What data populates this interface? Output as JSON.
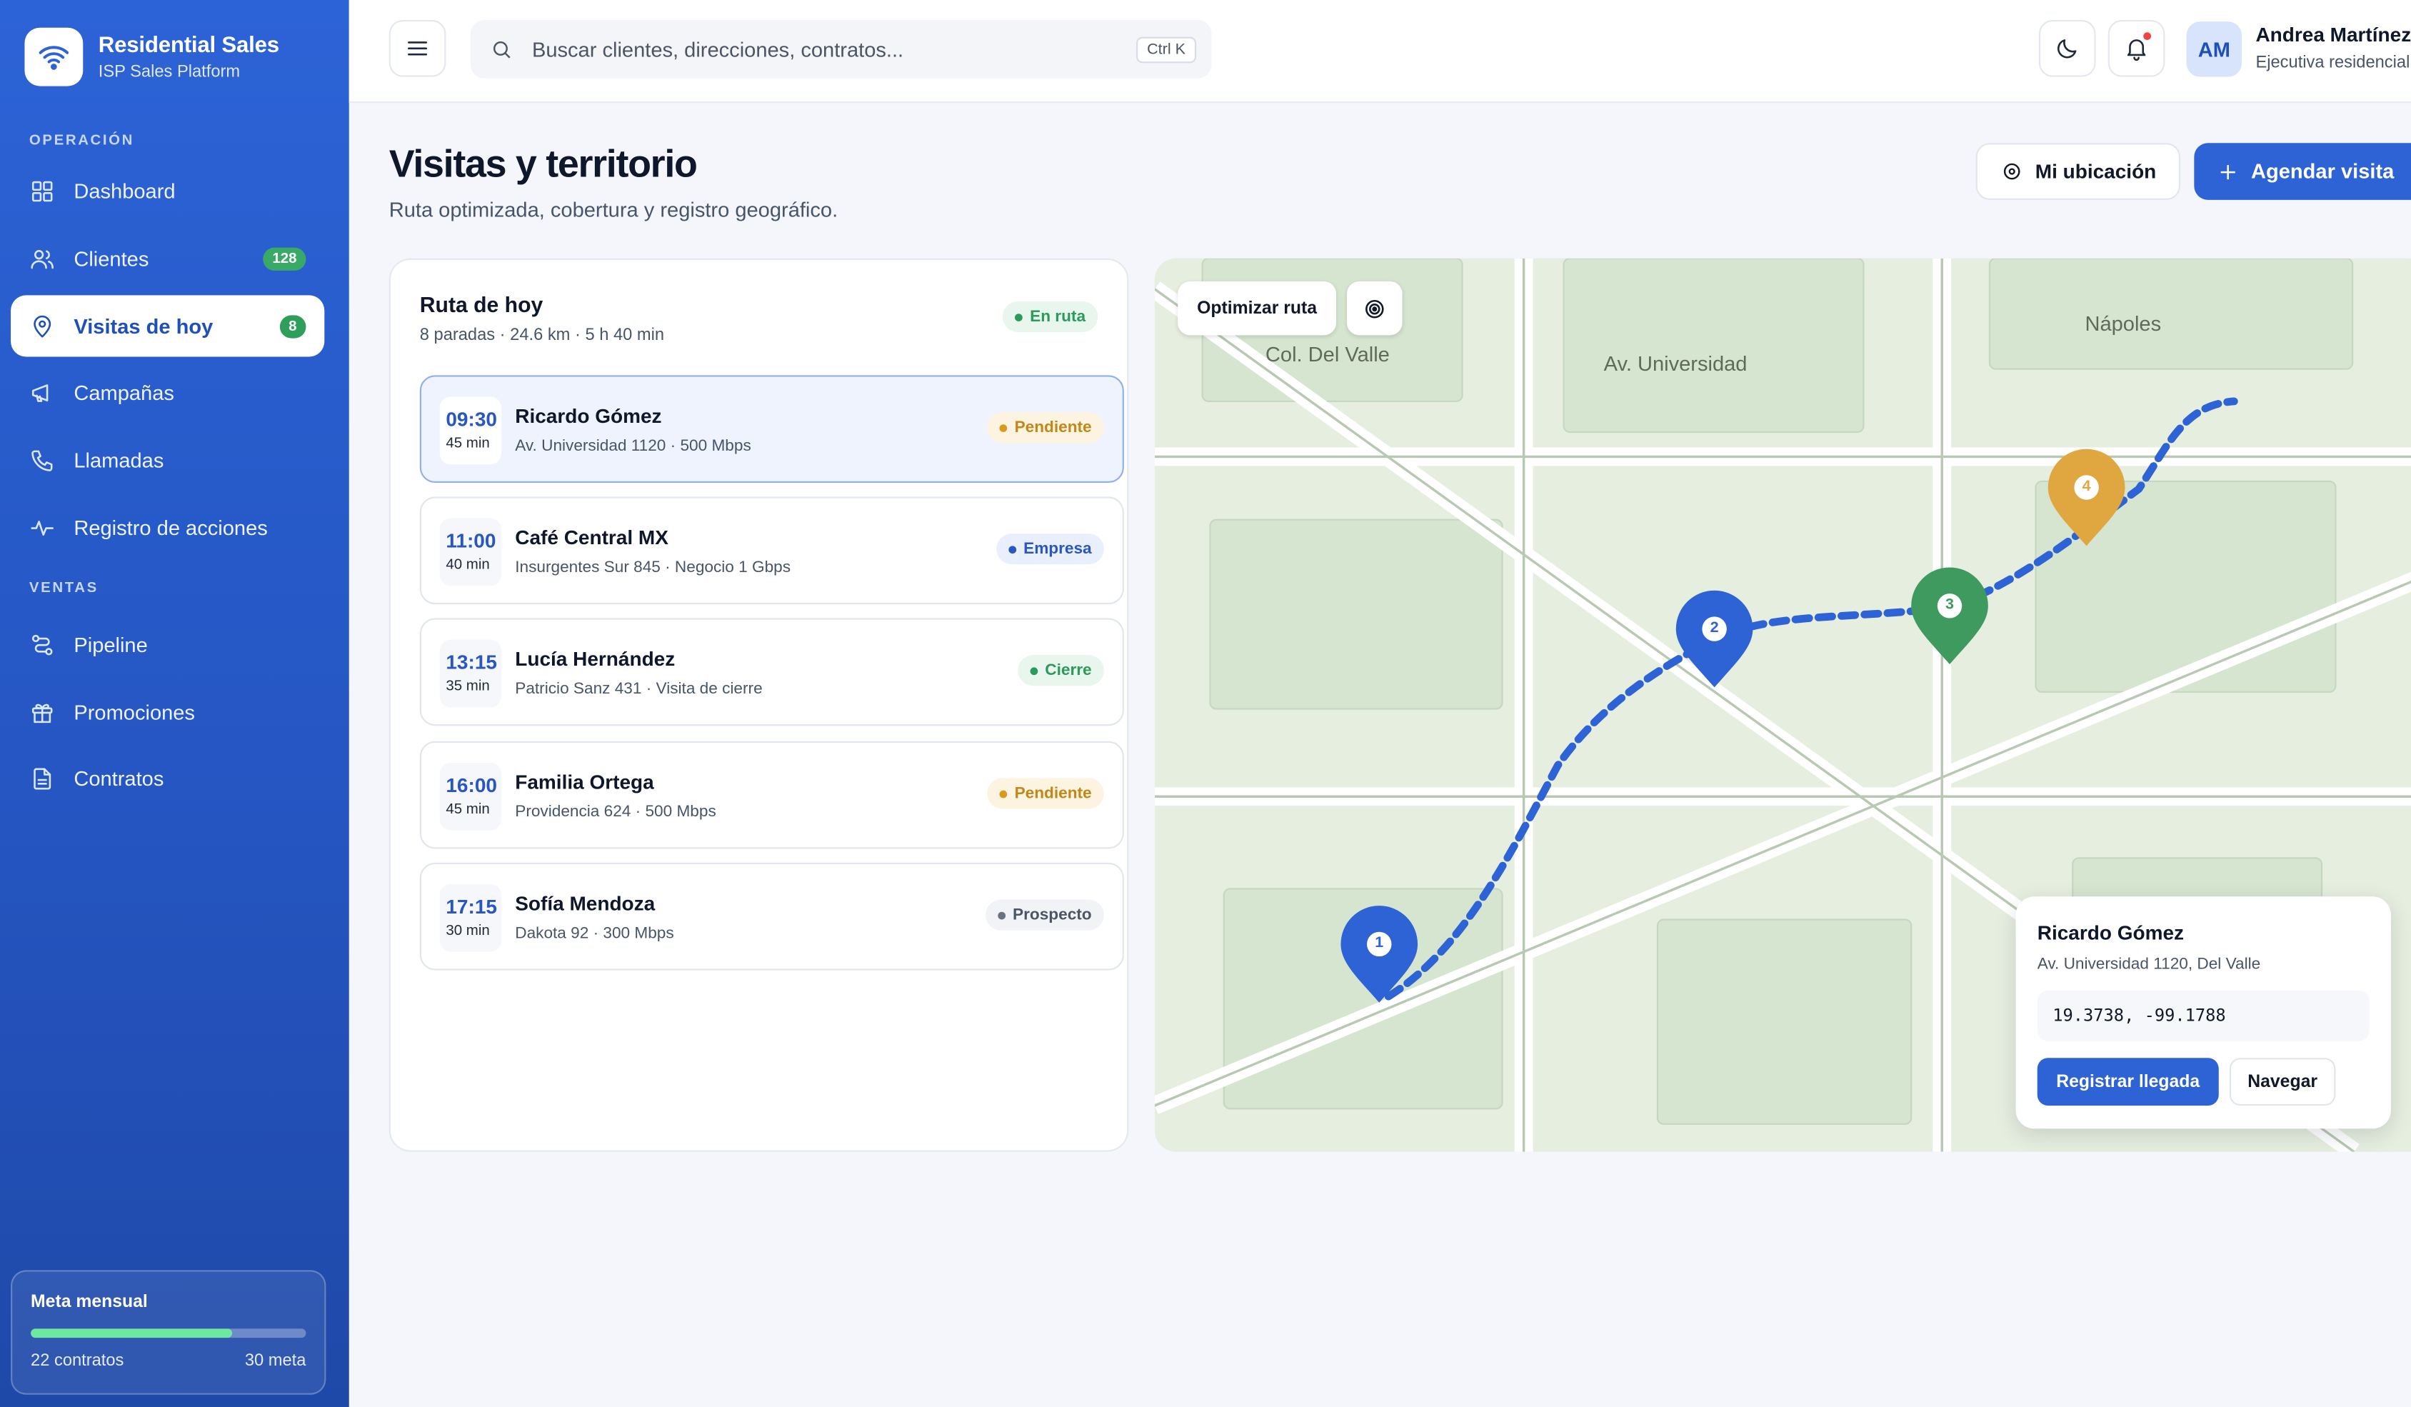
{
  "brand": {
    "title": "Residential Sales",
    "subtitle": "ISP Sales Platform",
    "icon": "wifi-icon"
  },
  "sidebar": {
    "sections": [
      {
        "label": "OPERACIÓN"
      },
      {
        "label": "VENTAS"
      }
    ],
    "items": [
      {
        "label": "Dashboard",
        "icon": "grid-icon"
      },
      {
        "label": "Clientes",
        "icon": "users-icon",
        "badge": "128"
      },
      {
        "label": "Visitas de hoy",
        "icon": "map-pin-icon",
        "badge": "8",
        "active": true
      },
      {
        "label": "Campañas",
        "icon": "megaphone-icon"
      },
      {
        "label": "Llamadas",
        "icon": "phone-icon"
      },
      {
        "label": "Registro de acciones",
        "icon": "activity-icon"
      },
      {
        "label": "Pipeline",
        "icon": "pipeline-icon"
      },
      {
        "label": "Promociones",
        "icon": "gift-icon"
      },
      {
        "label": "Contratos",
        "icon": "file-icon"
      }
    ],
    "goal": {
      "title": "Meta mensual",
      "left": "22 contratos",
      "right": "30 meta",
      "progress": 0.733
    }
  },
  "topbar": {
    "search_placeholder": "Buscar clientes, direcciones, contratos...",
    "shortcut": "Ctrl K",
    "user": {
      "initials": "AM",
      "name": "Andrea Martínez",
      "role": "Ejecutiva residencial"
    }
  },
  "page": {
    "title": "Visitas y territorio",
    "subtitle": "Ruta optimizada, cobertura y registro geográfico.",
    "location_button": "Mi ubicación",
    "schedule_button": "Agendar visita"
  },
  "route": {
    "title": "Ruta de hoy",
    "summary": "8 paradas · 24.6 km · 5 h 40 min",
    "status": "En ruta",
    "visits": [
      {
        "time": "09:30",
        "duration": "45 min",
        "name": "Ricardo Gómez",
        "detail": "Av. Universidad 1120 · 500 Mbps",
        "status": "Pendiente",
        "tone": "amber",
        "selected": true
      },
      {
        "time": "11:00",
        "duration": "40 min",
        "name": "Café Central MX",
        "detail": "Insurgentes Sur 845 · Negocio 1 Gbps",
        "status": "Empresa",
        "tone": "blue"
      },
      {
        "time": "13:15",
        "duration": "35 min",
        "name": "Lucía Hernández",
        "detail": "Patricio Sanz 431 · Visita de cierre",
        "status": "Cierre",
        "tone": "green"
      },
      {
        "time": "16:00",
        "duration": "45 min",
        "name": "Familia Ortega",
        "detail": "Providencia 624 · 500 Mbps",
        "status": "Pendiente",
        "tone": "amber"
      },
      {
        "time": "17:15",
        "duration": "30 min",
        "name": "Sofía Mendoza",
        "detail": "Dakota 92 · 300 Mbps",
        "status": "Prospecto",
        "tone": "gray"
      }
    ]
  },
  "map": {
    "optimize_button": "Optimizar ruta",
    "labels": {
      "a": "Col. Del Valle",
      "b": "Av. Universidad",
      "c": "Nápoles"
    },
    "pins": [
      {
        "number": "1",
        "color": "#2d63d4"
      },
      {
        "number": "2",
        "color": "#2d63d4"
      },
      {
        "number": "3",
        "color": "#3f9a5f"
      },
      {
        "number": "4",
        "color": "#e0a740"
      }
    ],
    "route_color": "#2d63d4",
    "popup": {
      "name": "Ricardo Gómez",
      "address": "Av. Universidad 1120, Del Valle",
      "coords": "19.3738, -99.1788",
      "primary": "Registrar llegada",
      "secondary": "Navegar"
    }
  }
}
